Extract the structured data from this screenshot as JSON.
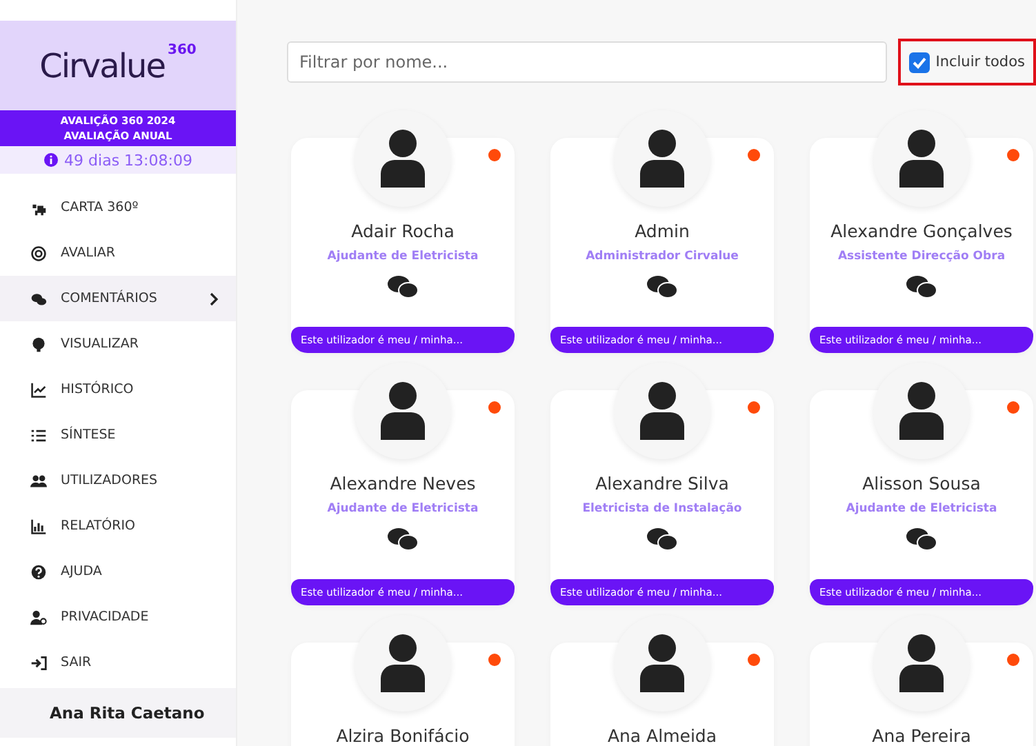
{
  "sidebar": {
    "logo": {
      "name": "Cirvalue",
      "superscript": "360"
    },
    "evaluation": {
      "title": "AVALIÇÃO 360 2024",
      "subtitle": "AVALIAÇÃO ANUAL"
    },
    "countdown": "49 dias 13:08:09",
    "items": [
      {
        "label": "CARTA 360º",
        "selected": false,
        "has_submenu": false
      },
      {
        "label": "AVALIAR",
        "selected": false,
        "has_submenu": false
      },
      {
        "label": "COMENTÁRIOS",
        "selected": true,
        "has_submenu": true
      },
      {
        "label": "VISUALIZAR",
        "selected": false,
        "has_submenu": false
      },
      {
        "label": "HISTÓRICO",
        "selected": false,
        "has_submenu": false
      },
      {
        "label": "SÍNTESE",
        "selected": false,
        "has_submenu": false
      },
      {
        "label": "UTILIZADORES",
        "selected": false,
        "has_submenu": false
      },
      {
        "label": "RELATÓRIO",
        "selected": false,
        "has_submenu": false
      },
      {
        "label": "AJUDA",
        "selected": false,
        "has_submenu": false
      },
      {
        "label": "PRIVACIDADE",
        "selected": false,
        "has_submenu": false
      },
      {
        "label": "SAIR",
        "selected": false,
        "has_submenu": false
      }
    ],
    "user": "Ana Rita Caetano"
  },
  "search": {
    "placeholder": "Filtrar por nome..."
  },
  "include_all": {
    "label": "Incluir todos",
    "checked": true
  },
  "users": [
    {
      "name": "Adair Rocha",
      "role": "Ajudante de Eletricista",
      "note": "Este utilizador é meu / minha..."
    },
    {
      "name": "Admin",
      "role": "Administrador Cirvalue",
      "note": "Este utilizador é meu / minha..."
    },
    {
      "name": "Alexandre Gonçalves",
      "role": "Assistente Direcção Obra",
      "note": "Este utilizador é meu / minha..."
    },
    {
      "name": "Alexandre Neves",
      "role": "Ajudante de Eletricista",
      "note": "Este utilizador é meu / minha..."
    },
    {
      "name": "Alexandre Silva",
      "role": "Eletricista de Instalação",
      "note": "Este utilizador é meu / minha..."
    },
    {
      "name": "Alisson Sousa",
      "role": "Ajudante de Eletricista",
      "note": "Este utilizador é meu / minha..."
    },
    {
      "name": "Alzira Bonifácio"
    },
    {
      "name": "Ana Almeida"
    },
    {
      "name": "Ana Pereira"
    }
  ]
}
